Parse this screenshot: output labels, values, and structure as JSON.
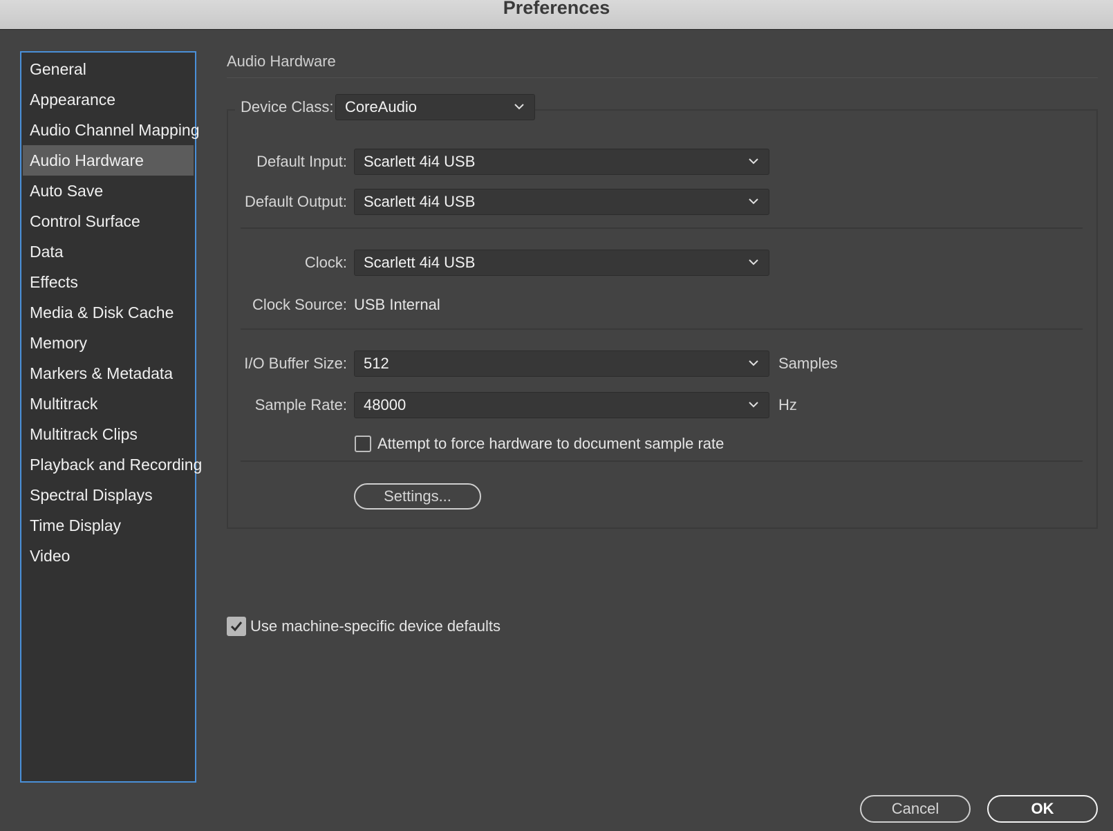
{
  "window": {
    "title": "Preferences"
  },
  "sidebar": {
    "selected_index": 3,
    "items": [
      {
        "label": "General"
      },
      {
        "label": "Appearance"
      },
      {
        "label": "Audio Channel Mapping"
      },
      {
        "label": "Audio Hardware"
      },
      {
        "label": "Auto Save"
      },
      {
        "label": "Control Surface"
      },
      {
        "label": "Data"
      },
      {
        "label": "Effects"
      },
      {
        "label": "Media & Disk Cache"
      },
      {
        "label": "Memory"
      },
      {
        "label": "Markers & Metadata"
      },
      {
        "label": "Multitrack"
      },
      {
        "label": "Multitrack Clips"
      },
      {
        "label": "Playback and Recording"
      },
      {
        "label": "Spectral Displays"
      },
      {
        "label": "Time Display"
      },
      {
        "label": "Video"
      }
    ]
  },
  "panel": {
    "section_title": "Audio Hardware",
    "device_class": {
      "label": "Device Class:",
      "value": "CoreAudio"
    },
    "default_input": {
      "label": "Default Input:",
      "value": "Scarlett 4i4 USB"
    },
    "default_output": {
      "label": "Default Output:",
      "value": "Scarlett 4i4 USB"
    },
    "clock": {
      "label": "Clock:",
      "value": "Scarlett 4i4 USB"
    },
    "clock_source": {
      "label": "Clock Source:",
      "value": "USB Internal"
    },
    "io_buffer_size": {
      "label": "I/O Buffer Size:",
      "value": "512",
      "unit": "Samples"
    },
    "sample_rate": {
      "label": "Sample Rate:",
      "value": "48000",
      "unit": "Hz"
    },
    "force_sample_rate": {
      "label": "Attempt to force hardware to document sample rate",
      "checked": false
    },
    "settings_button": "Settings...",
    "machine_defaults": {
      "label": "Use machine-specific device defaults",
      "checked": true
    }
  },
  "footer": {
    "cancel": "Cancel",
    "ok": "OK"
  },
  "icons": {
    "dropdown": "chevron-down-icon",
    "check": "checkmark-icon"
  },
  "colors": {
    "background": "#434343",
    "sidebar_background": "#323232",
    "sidebar_focus_border": "#4a90d9",
    "sidebar_selected": "#5c5c5c",
    "titlebar": "#d0d0d0"
  }
}
